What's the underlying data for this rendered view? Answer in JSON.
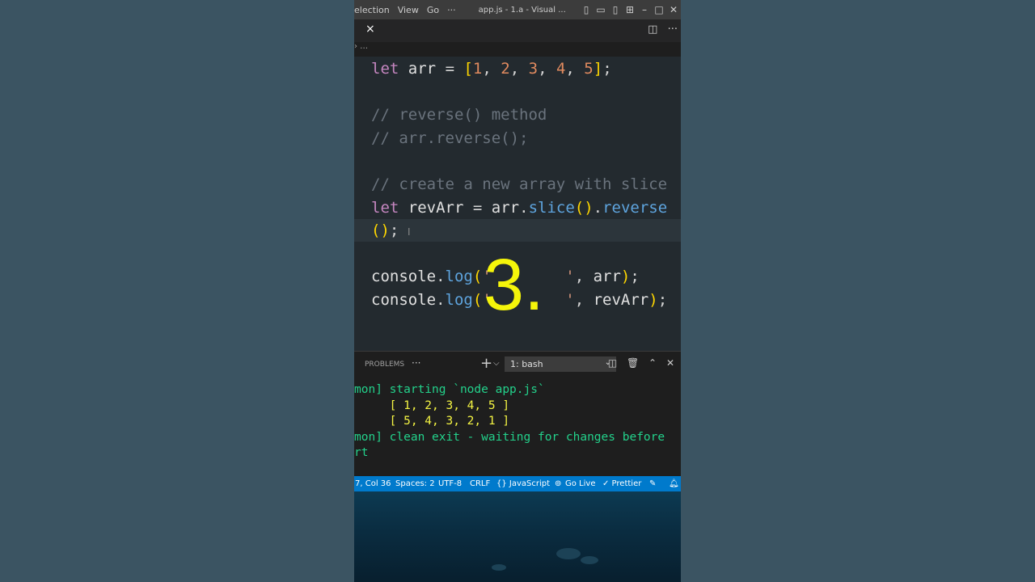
{
  "titlebar": {
    "menus": [
      "election",
      "View",
      "Go",
      "···"
    ],
    "title": "app.js - 1.a - Visual ...",
    "icons": [
      "layout-sidebar-icon",
      "layout-panel-icon",
      "layout-sidebar-right-icon",
      "customize-layout-icon",
      "minimize-icon",
      "maximize-icon",
      "close-icon"
    ]
  },
  "tab": {
    "close": "×",
    "actions": [
      "split-editor-icon",
      "more-icon"
    ]
  },
  "breadcrumb": "›  …",
  "editor": {
    "lines": [
      "let arr = [1, 2, 3, 4, 5];",
      "",
      "// reverse() method",
      "// arr.reverse();",
      "",
      "// create a new array with slice",
      "let revArr = arr.slice().reverse",
      "();",
      "",
      "console.log('        ', arr);",
      "console.log('        ', revArr);"
    ],
    "overlay_number": "3."
  },
  "panel": {
    "tab": "PROBLEMS",
    "more": "···",
    "add": "+",
    "terminal_select": "1: bash",
    "icons": [
      "split-terminal-icon",
      "trash-icon",
      "maximize-panel-icon",
      "close-panel-icon"
    ]
  },
  "terminal": {
    "line1": "mon] starting `node app.js`",
    "line2": "     [ 1, 2, 3, 4, 5 ]",
    "line3": "     [ 5, 4, 3, 2, 1 ]",
    "line4": "mon] clean exit - waiting for changes before",
    "line5": "rt"
  },
  "statusbar": {
    "position": "7, Col 36",
    "spaces": "Spaces: 2",
    "encoding": "UTF-8",
    "eol": "CRLF",
    "language": "{} JavaScript",
    "golive": "Go Live",
    "prettier": "✓ Prettier"
  },
  "colors": {
    "statusbar": "#007acc",
    "keyword": "#c586c0",
    "number": "#e08a5f",
    "bracket": "#ffd700",
    "comment": "#6a737d",
    "function": "#5ea4de",
    "overlay": "#f5f50a",
    "terminal_green": "#23d18b",
    "terminal_yellow": "#f5f543"
  }
}
